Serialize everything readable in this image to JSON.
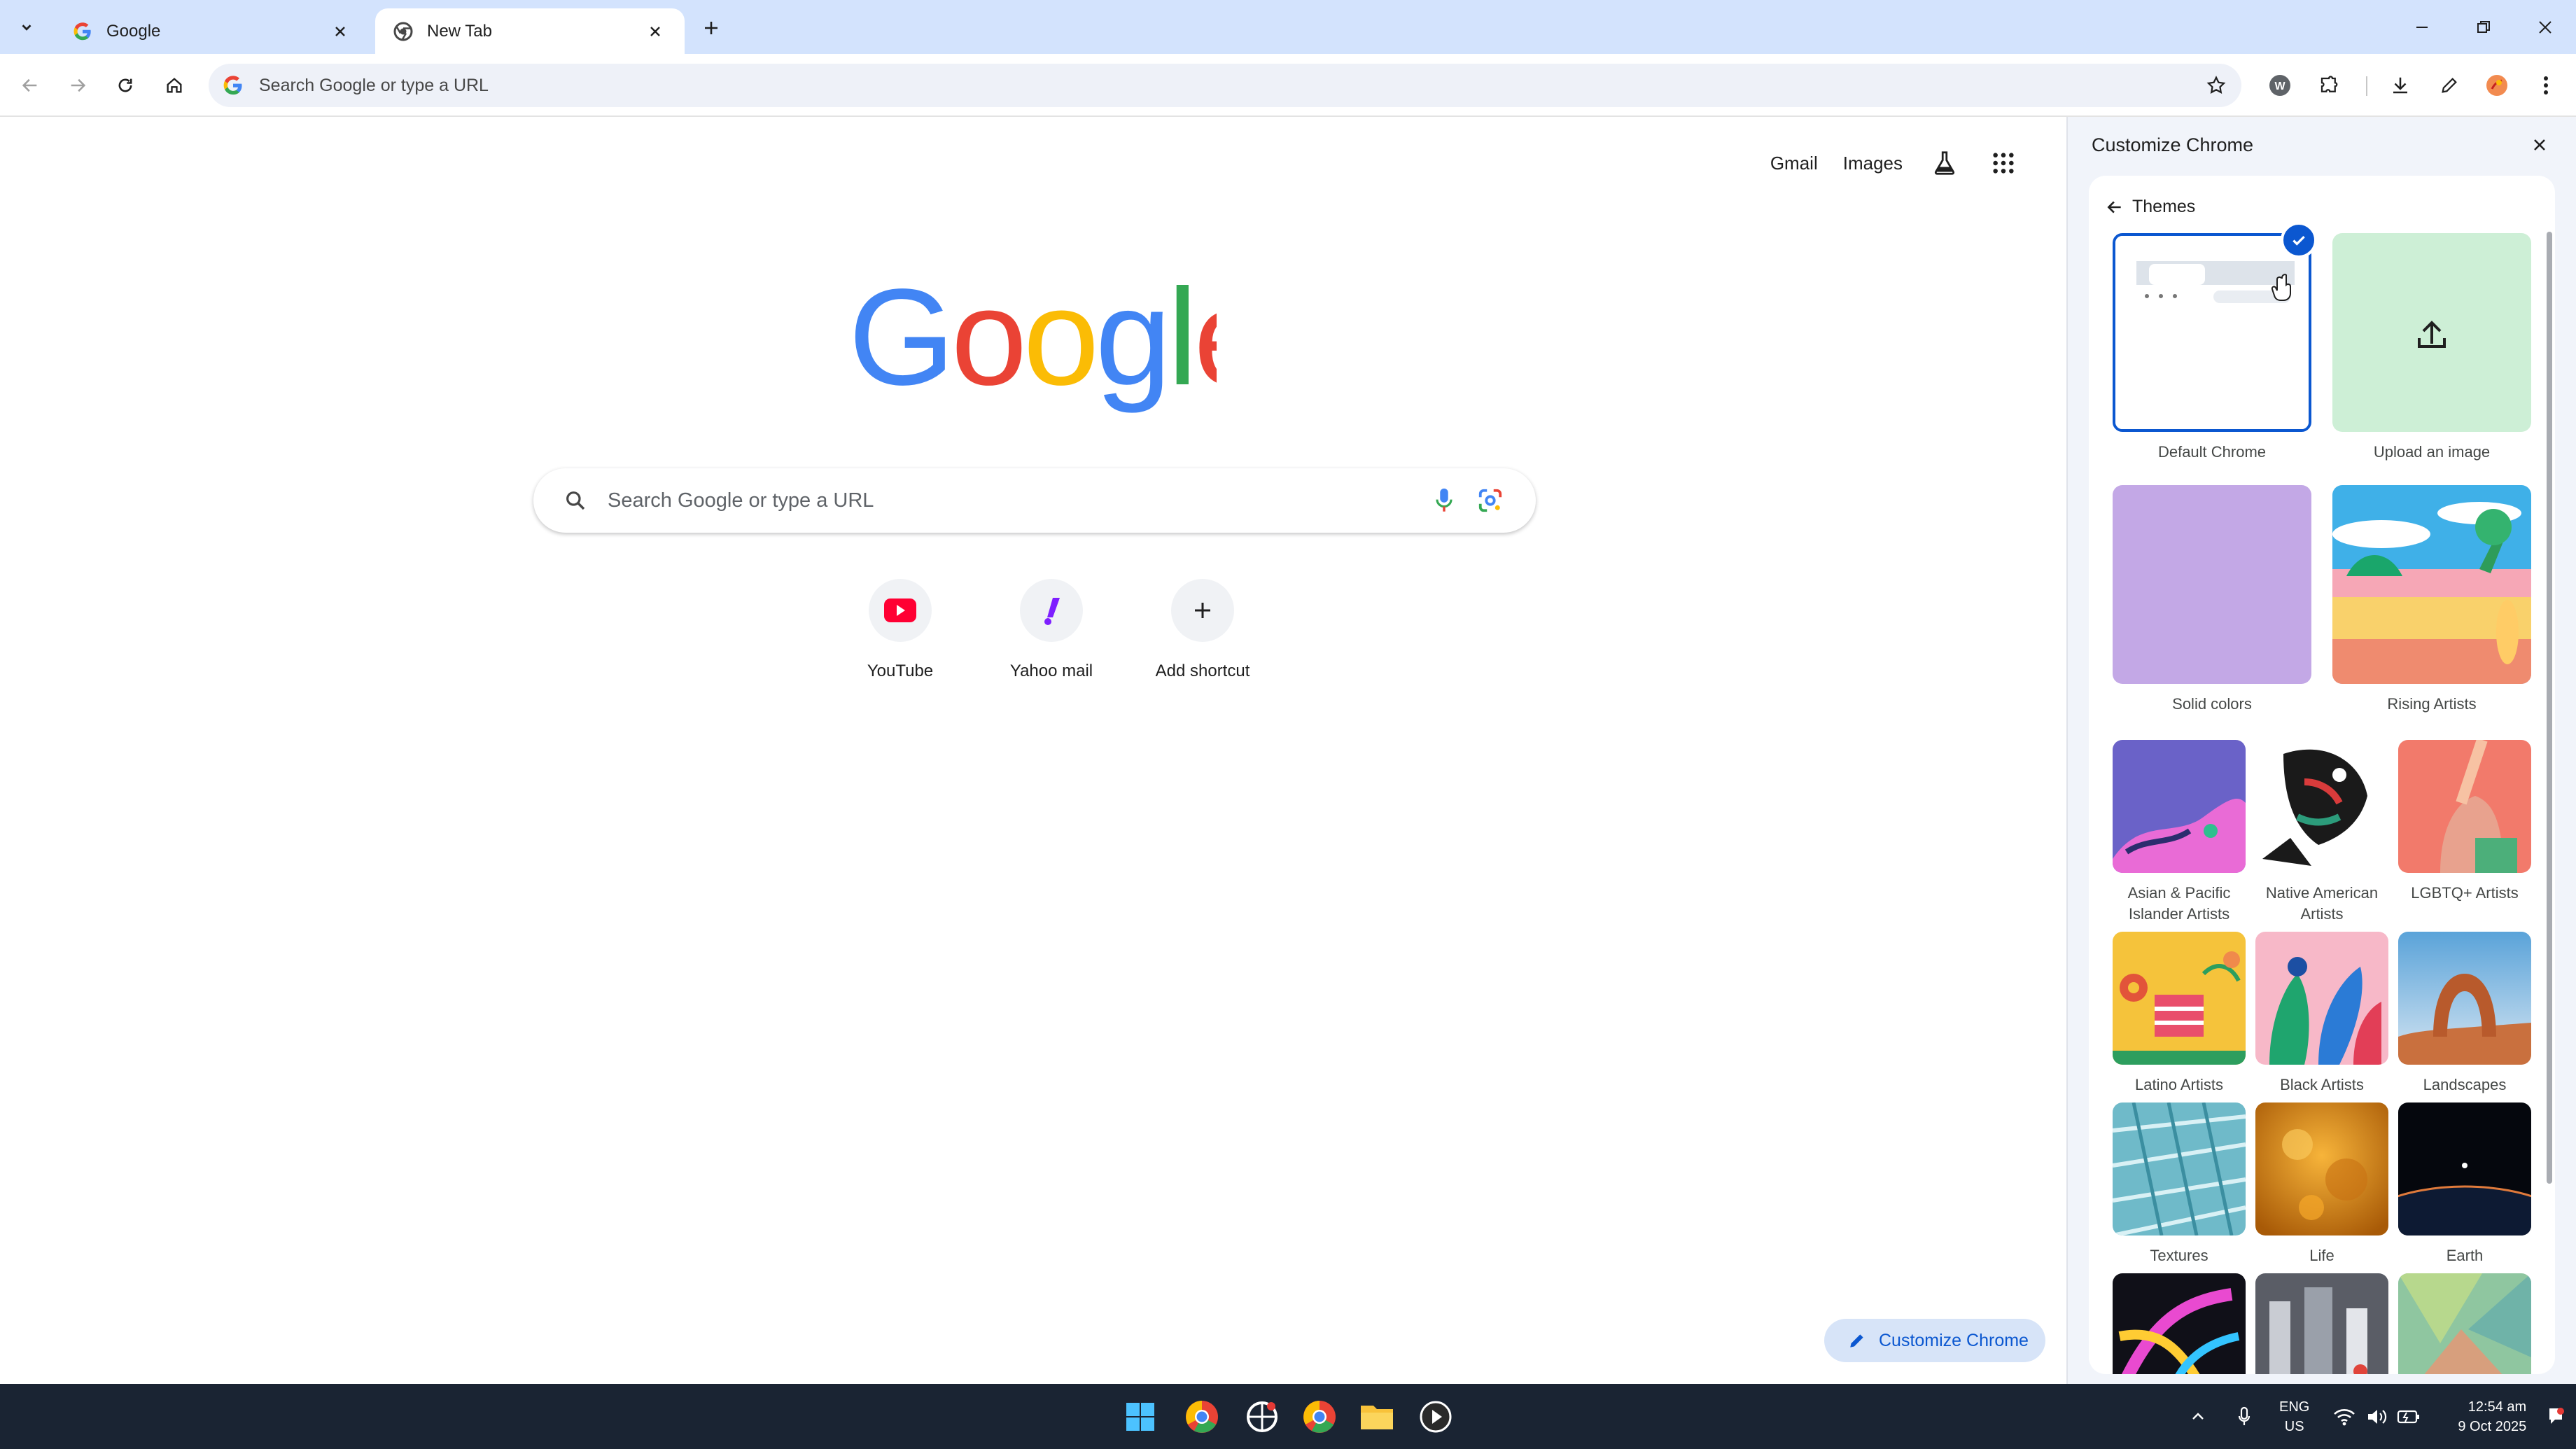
{
  "browser": {
    "tabs": [
      {
        "title": "Google",
        "active": false
      },
      {
        "title": "New Tab",
        "active": true
      }
    ],
    "omnibox_placeholder": "Search Google or type a URL"
  },
  "ntp": {
    "top_links": {
      "gmail": "Gmail",
      "images": "Images"
    },
    "search_placeholder": "Search Google or type a URL",
    "logo_text": "Google",
    "shortcuts": [
      {
        "label": "YouTube",
        "icon": "youtube-icon"
      },
      {
        "label": "Yahoo mail",
        "icon": "yahoo-icon"
      },
      {
        "label": "Add shortcut",
        "icon": "plus-icon"
      }
    ],
    "customize_button": "Customize Chrome"
  },
  "side_panel": {
    "title": "Customize Chrome",
    "back_label": "Themes",
    "themes_large": [
      {
        "label": "Default Chrome",
        "selected": true
      },
      {
        "label": "Upload an image"
      },
      {
        "label": "Solid colors"
      },
      {
        "label": "Rising Artists"
      }
    ],
    "themes_small": [
      {
        "label": "Asian & Pacific Islander Artists"
      },
      {
        "label": "Native American Artists"
      },
      {
        "label": "LGBTQ+ Artists"
      },
      {
        "label": "Latino Artists"
      },
      {
        "label": "Black Artists"
      },
      {
        "label": "Landscapes"
      },
      {
        "label": "Textures"
      },
      {
        "label": "Life"
      },
      {
        "label": "Earth"
      }
    ]
  },
  "taskbar": {
    "lang_line1": "ENG",
    "lang_line2": "US",
    "time": "12:54 am",
    "date": "9 Oct 2025"
  },
  "colors": {
    "accent": "#0b57d0",
    "tabstrip": "#d3e3fd",
    "taskbar": "#1a2433"
  }
}
